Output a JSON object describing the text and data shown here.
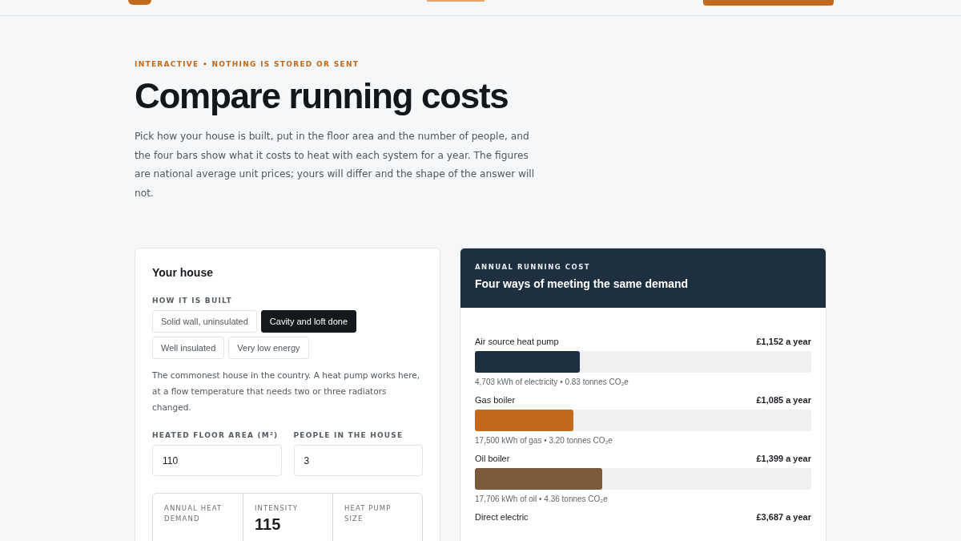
{
  "eyebrow": "INTERACTIVE • NOTHING IS STORED OR SENT",
  "title": "Compare running costs",
  "intro": "Pick how your house is built, put in the floor area and the number of people, and the four bars show what it costs to heat with each system for a year. The figures are national average unit prices; yours will differ and the shape of the answer will not.",
  "house": {
    "title": "Your house",
    "built_label": "HOW IT IS BUILT",
    "options": [
      {
        "label": "Solid wall, uninsulated",
        "selected": false
      },
      {
        "label": "Cavity and loft done",
        "selected": true
      },
      {
        "label": "Well insulated",
        "selected": false
      },
      {
        "label": "Very low energy",
        "selected": false
      }
    ],
    "description": "The commonest house in the country. A heat pump works here, at a flow temperature that needs two or three radiators changed.",
    "fields": [
      {
        "label": "HEATED FLOOR AREA (M²)",
        "value": "110"
      },
      {
        "label": "PEOPLE IN THE HOUSE",
        "value": "3"
      }
    ],
    "stats": [
      {
        "label": "ANNUAL HEAT DEMAND"
      },
      {
        "label": "INTENSITY",
        "value": "115"
      },
      {
        "label": "HEAT PUMP SIZE"
      }
    ]
  },
  "costs": {
    "eyebrow": "ANNUAL RUNNING COST",
    "title": "Four ways of meeting the same demand",
    "systems": [
      {
        "name": "Air source heat pump",
        "cost": "£1,152 a year",
        "level": 0.312,
        "color": "#1e2f3f",
        "detail": "4,703 kWh of electricity • 0.83 tonnes CO₂e"
      },
      {
        "name": "Gas boiler",
        "cost": "£1,085 a year",
        "level": 0.294,
        "color": "#c2691d",
        "detail": "17,500 kWh of gas • 3.20 tonnes CO₂e"
      },
      {
        "name": "Oil boiler",
        "cost": "£1,399 a year",
        "level": 0.379,
        "color": "#7a5a3a",
        "detail": "17,706 kWh of oil • 4.36 tonnes CO₂e"
      },
      {
        "name": "Direct electric",
        "cost": "£3,687 a year"
      }
    ]
  }
}
